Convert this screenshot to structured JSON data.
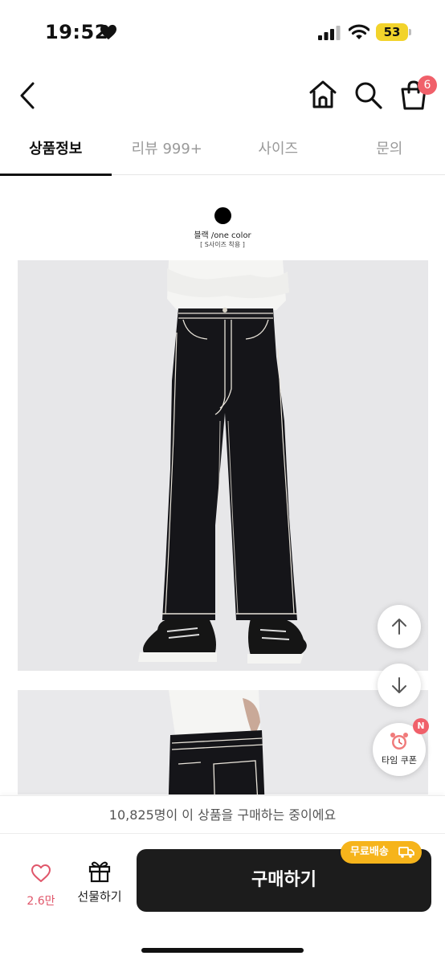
{
  "status_bar": {
    "time": "19:52",
    "battery": "53",
    "icons": [
      "heart-icon",
      "signal-icon",
      "wifi-icon",
      "battery-icon"
    ]
  },
  "nav": {
    "cart_count": "6",
    "icons": [
      "chevron-left-icon",
      "home-icon",
      "search-icon",
      "shopping-bag-icon"
    ]
  },
  "tabs": [
    {
      "label": "상품정보",
      "active": true
    },
    {
      "label": "리뷰 999+",
      "active": false
    },
    {
      "label": "사이즈",
      "active": false
    },
    {
      "label": "문의",
      "active": false
    }
  ],
  "product": {
    "color_name": "블랙 /one color",
    "size_note": "[ S사이즈 착용 ]",
    "colors": {
      "jeans": "#151519",
      "stitching": "#e9e4da",
      "background": "#e7e7e9"
    }
  },
  "floating": {
    "coupon_label": "타임 쿠폰",
    "coupon_badge": "N",
    "icons": [
      "arrow-up-icon",
      "arrow-down-icon",
      "alarm-clock-icon"
    ]
  },
  "notice": {
    "text": "10,825명이 이 상품을 구매하는 중이에요"
  },
  "bottom_bar": {
    "like_count": "2.6만",
    "gift_label": "선물하기",
    "buy_label": "구매하기",
    "free_shipping": "무료배송",
    "icons": [
      "heart-outline-icon",
      "gift-icon",
      "truck-icon"
    ]
  },
  "colors": {
    "accent_red": "#f0606a",
    "shipping_yellow": "#f6b41b",
    "buy_button": "#1c1c1c"
  }
}
